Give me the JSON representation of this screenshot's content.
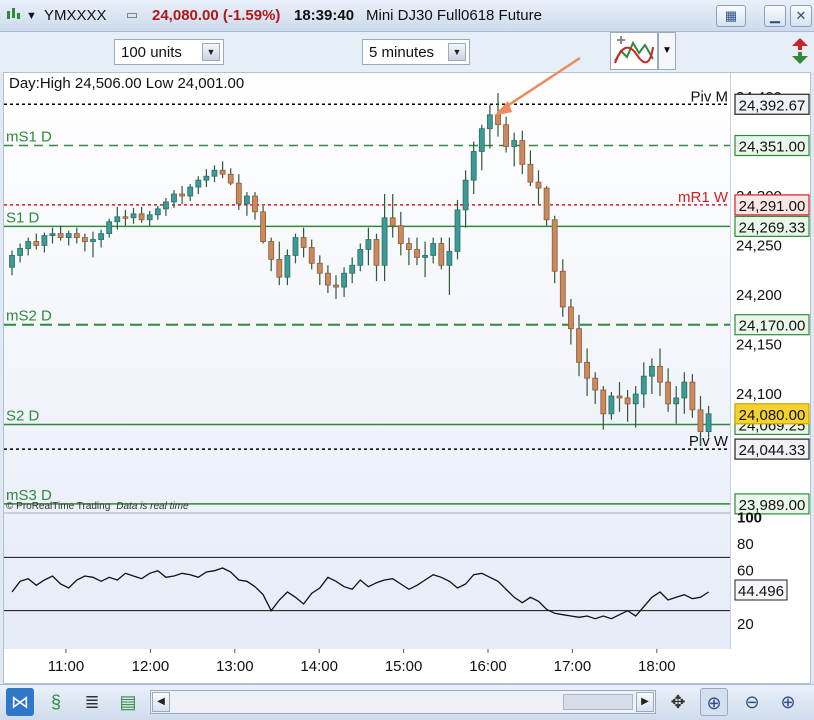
{
  "window": {
    "symbol": "YMXXXX",
    "price": "24,080.00",
    "change": "(-1.59%)",
    "time": "18:39:40",
    "instrument": "Mini DJ30 Full0618 Future"
  },
  "toolbar": {
    "units": "100 units",
    "interval": "5 minutes"
  },
  "chart_data": {
    "type": "candlestick",
    "info": "Day:High 24,506.00 Low 24,001.00",
    "watermark": "© ProRealTime Trading",
    "watermark_note": "Data is real time",
    "x_ticks": [
      "11:00",
      "12:00",
      "13:00",
      "14:00",
      "15:00",
      "16:00",
      "17:00",
      "18:00"
    ],
    "y_ticks": [
      "24,400",
      "24,300",
      "24,250",
      "24,200",
      "24,150",
      "24,100"
    ],
    "ylim": [
      23975,
      24506
    ],
    "levels": [
      {
        "left": "",
        "right": "Piv M",
        "value": 24392.67,
        "tag": "24,392.67",
        "color": "#000000",
        "style": "dotted"
      },
      {
        "left": "mS1 D",
        "right": "",
        "value": 24351.0,
        "tag": "24,351.00",
        "color": "#2f8a3a",
        "style": "dashed"
      },
      {
        "left": "",
        "right": "mR1 W",
        "value": 24291.0,
        "tag": "24,291.00",
        "color": "#d21f1f",
        "style": "dotted"
      },
      {
        "left": "S1 D",
        "right": "",
        "value": 24269.33,
        "tag": "24,269.33",
        "color": "#2f8a3a",
        "style": "solid"
      },
      {
        "left": "mS2 D",
        "right": "",
        "value": 24170.0,
        "tag": "24,170.00",
        "color": "#2f8a3a",
        "style": "bigdash"
      },
      {
        "left": "S2 D",
        "right": "",
        "value": 24069.25,
        "tag": "24,069.25",
        "color": "#2f8a3a",
        "style": "solid"
      },
      {
        "left": "",
        "right": "Piv W",
        "value": 24044.33,
        "tag": "24,044.33",
        "color": "#000000",
        "style": "dotted"
      },
      {
        "left": "mS3 D",
        "right": "",
        "value": 23989.0,
        "tag": "23,989.00",
        "color": "#2f8a3a",
        "style": "solid"
      }
    ],
    "last_price": {
      "value": 24080.0,
      "tag": "24,080.00"
    },
    "candles": [
      [
        24228,
        24245,
        24220,
        24240
      ],
      [
        24240,
        24252,
        24233,
        24247
      ],
      [
        24247,
        24258,
        24240,
        24254
      ],
      [
        24254,
        24262,
        24246,
        24250
      ],
      [
        24250,
        24263,
        24243,
        24260
      ],
      [
        24260,
        24268,
        24252,
        24262
      ],
      [
        24262,
        24270,
        24255,
        24258
      ],
      [
        24258,
        24265,
        24250,
        24262
      ],
      [
        24262,
        24268,
        24252,
        24258
      ],
      [
        24258,
        24262,
        24244,
        24254
      ],
      [
        24254,
        24264,
        24238,
        24256
      ],
      [
        24256,
        24266,
        24248,
        24262
      ],
      [
        24262,
        24277,
        24258,
        24274
      ],
      [
        24274,
        24289,
        24266,
        24279
      ],
      [
        24279,
        24286,
        24270,
        24278
      ],
      [
        24278,
        24288,
        24272,
        24282
      ],
      [
        24282,
        24289,
        24273,
        24276
      ],
      [
        24276,
        24285,
        24270,
        24281
      ],
      [
        24281,
        24290,
        24276,
        24287
      ],
      [
        24287,
        24298,
        24280,
        24294
      ],
      [
        24294,
        24306,
        24288,
        24302
      ],
      [
        24302,
        24310,
        24292,
        24300
      ],
      [
        24300,
        24312,
        24295,
        24309
      ],
      [
        24309,
        24320,
        24302,
        24316
      ],
      [
        24316,
        24327,
        24309,
        24320
      ],
      [
        24320,
        24331,
        24314,
        24326
      ],
      [
        24326,
        24335,
        24318,
        24322
      ],
      [
        24322,
        24328,
        24311,
        24313
      ],
      [
        24313,
        24322,
        24286,
        24292
      ],
      [
        24292,
        24304,
        24280,
        24300
      ],
      [
        24300,
        24304,
        24276,
        24284
      ],
      [
        24284,
        24290,
        24252,
        24254
      ],
      [
        24254,
        24258,
        24224,
        24236
      ],
      [
        24236,
        24254,
        24210,
        24218
      ],
      [
        24218,
        24246,
        24210,
        24240
      ],
      [
        24240,
        24262,
        24232,
        24258
      ],
      [
        24258,
        24268,
        24238,
        24248
      ],
      [
        24248,
        24256,
        24226,
        24232
      ],
      [
        24232,
        24240,
        24210,
        24222
      ],
      [
        24222,
        24230,
        24202,
        24210
      ],
      [
        24210,
        24220,
        24196,
        24208
      ],
      [
        24208,
        24228,
        24198,
        24222
      ],
      [
        24222,
        24238,
        24212,
        24230
      ],
      [
        24230,
        24252,
        24224,
        24246
      ],
      [
        24246,
        24268,
        24230,
        24256
      ],
      [
        24256,
        24262,
        24214,
        24230
      ],
      [
        24230,
        24302,
        24214,
        24278
      ],
      [
        24278,
        24302,
        24258,
        24270
      ],
      [
        24270,
        24284,
        24240,
        24252
      ],
      [
        24252,
        24258,
        24230,
        24246
      ],
      [
        24246,
        24258,
        24230,
        24238
      ],
      [
        24238,
        24254,
        24218,
        24240
      ],
      [
        24240,
        24258,
        24232,
        24252
      ],
      [
        24252,
        24258,
        24226,
        24230
      ],
      [
        24230,
        24258,
        24200,
        24244
      ],
      [
        24244,
        24296,
        24236,
        24286
      ],
      [
        24286,
        24326,
        24268,
        24316
      ],
      [
        24316,
        24355,
        24302,
        24345
      ],
      [
        24345,
        24372,
        24326,
        24368
      ],
      [
        24368,
        24392,
        24348,
        24382
      ],
      [
        24382,
        24404,
        24360,
        24372
      ],
      [
        24372,
        24380,
        24344,
        24350
      ],
      [
        24350,
        24364,
        24330,
        24356
      ],
      [
        24356,
        24366,
        24322,
        24332
      ],
      [
        24332,
        24346,
        24310,
        24314
      ],
      [
        24314,
        24326,
        24292,
        24308
      ],
      [
        24308,
        24310,
        24270,
        24276
      ],
      [
        24276,
        24280,
        24212,
        24224
      ],
      [
        24224,
        24236,
        24178,
        24188
      ],
      [
        24188,
        24196,
        24150,
        24166
      ],
      [
        24166,
        24180,
        24118,
        24132
      ],
      [
        24132,
        24146,
        24098,
        24116
      ],
      [
        24116,
        24122,
        24090,
        24104
      ],
      [
        24104,
        24108,
        24064,
        24080
      ],
      [
        24080,
        24102,
        24074,
        24098
      ],
      [
        24098,
        24112,
        24082,
        24096
      ],
      [
        24096,
        24104,
        24072,
        24090
      ],
      [
        24090,
        24108,
        24066,
        24100
      ],
      [
        24100,
        24132,
        24086,
        24118
      ],
      [
        24118,
        24136,
        24100,
        24128
      ],
      [
        24128,
        24146,
        24098,
        24112
      ],
      [
        24112,
        24126,
        24082,
        24090
      ],
      [
        24090,
        24108,
        24070,
        24096
      ],
      [
        24096,
        24122,
        24080,
        24112
      ],
      [
        24112,
        24120,
        24076,
        24084
      ],
      [
        24084,
        24098,
        24048,
        24062
      ],
      [
        24062,
        24088,
        24056,
        24080
      ]
    ],
    "indicator": {
      "y_ticks": [
        "100",
        "80",
        "60",
        "20"
      ],
      "ylim": [
        0,
        100
      ],
      "overbought": 70,
      "oversold": 30,
      "value_tag": "44.496",
      "values": [
        44,
        52,
        54,
        49,
        53,
        56,
        50,
        47,
        53,
        56,
        55,
        52,
        55,
        53,
        58,
        56,
        54,
        58,
        60,
        55,
        56,
        58,
        57,
        55,
        59,
        60,
        62,
        59,
        53,
        52,
        48,
        42,
        30,
        38,
        44,
        40,
        35,
        43,
        47,
        55,
        52,
        48,
        46,
        53,
        48,
        51,
        53,
        54,
        50,
        46,
        49,
        53,
        57,
        55,
        52,
        47,
        50,
        57,
        58,
        55,
        52,
        46,
        40,
        36,
        40,
        37,
        31,
        28,
        27,
        26,
        25,
        26,
        24,
        26,
        24,
        27,
        30,
        26,
        33,
        40,
        44,
        38,
        40,
        42,
        39,
        40,
        44
      ]
    }
  }
}
